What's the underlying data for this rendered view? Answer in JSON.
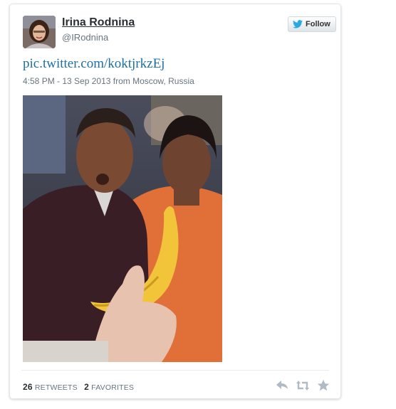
{
  "tweet": {
    "user": {
      "display_name": "Irina Rodnina",
      "screen_name": "@IRodnina",
      "avatar_icon": "avatar-photo"
    },
    "follow_label": "Follow",
    "link_text": "pic.twitter.com/koktjrkzEj",
    "timestamp": "4:58 PM - 13 Sep 2013 from Moscow, Russia",
    "photo_icon": "embedded-photo",
    "stats": {
      "retweets_count": "26",
      "retweets_label": "RETWEETS",
      "favorites_count": "2",
      "favorites_label": "FAVORITES"
    },
    "actions": [
      "reply-icon",
      "retweet-icon",
      "favorite-icon"
    ]
  },
  "colors": {
    "link": "#1d6fa5",
    "twitter_blue": "#2aa9e0",
    "muted": "#66757f",
    "action_gray": "#b1bbc3"
  }
}
